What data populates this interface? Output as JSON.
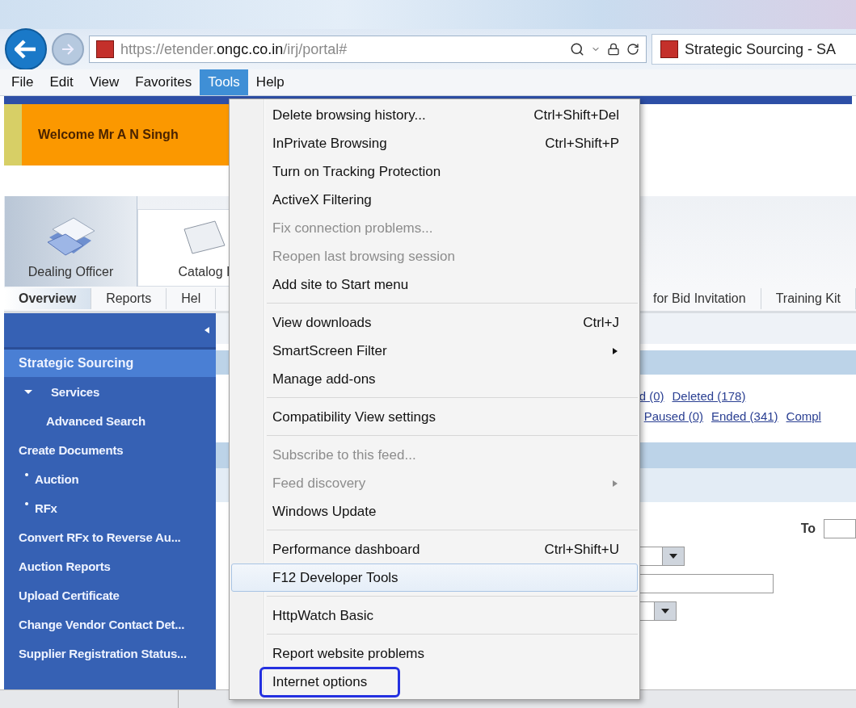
{
  "browser": {
    "address": "https://etender.**ongc.co.in**/irj/portal#",
    "tab_title": "Strategic Sourcing - SA"
  },
  "menu_bar": [
    {
      "label": "File",
      "selected": false
    },
    {
      "label": "Edit",
      "selected": false
    },
    {
      "label": "View",
      "selected": false
    },
    {
      "label": "Favorites",
      "selected": false
    },
    {
      "label": "Tools",
      "selected": true
    },
    {
      "label": "Help",
      "selected": false
    }
  ],
  "tools_menu": [
    [
      {
        "label": "Delete browsing history...",
        "shortcut": "Ctrl+Shift+Del",
        "disabled": false,
        "selected": false
      },
      {
        "label": "InPrivate Browsing",
        "shortcut": "Ctrl+Shift+P",
        "disabled": false,
        "selected": false
      },
      {
        "label": "Turn on Tracking Protection",
        "disabled": false,
        "selected": false
      },
      {
        "label": "ActiveX Filtering",
        "disabled": false,
        "selected": false
      },
      {
        "label": "Fix connection problems...",
        "disabled": true,
        "selected": false
      },
      {
        "label": "Reopen last browsing session",
        "disabled": true,
        "selected": false
      },
      {
        "label": "Add site to Start menu",
        "disabled": false,
        "selected": false
      }
    ],
    [
      {
        "label": "View downloads",
        "shortcut": "Ctrl+J",
        "disabled": false,
        "selected": false
      },
      {
        "label": "SmartScreen Filter",
        "submenu": true,
        "disabled": false,
        "selected": false
      },
      {
        "label": "Manage add-ons",
        "disabled": false,
        "selected": false
      }
    ],
    [
      {
        "label": "Compatibility View settings",
        "disabled": false,
        "selected": false
      }
    ],
    [
      {
        "label": "Subscribe to this feed...",
        "disabled": true,
        "selected": false
      },
      {
        "label": "Feed discovery",
        "submenu": true,
        "disabled": true,
        "selected": false
      },
      {
        "label": "Windows Update",
        "disabled": false,
        "selected": false
      }
    ],
    [
      {
        "label": "Performance dashboard",
        "shortcut": "Ctrl+Shift+U",
        "disabled": false,
        "selected": false
      },
      {
        "label": "F12 Developer Tools",
        "disabled": false,
        "selected": true
      }
    ],
    [
      {
        "label": "HttpWatch Basic",
        "disabled": false,
        "selected": false
      }
    ],
    [
      {
        "label": "Report website problems",
        "disabled": false,
        "selected": false
      },
      {
        "label": "Internet options",
        "disabled": false,
        "selected": false,
        "highlighted": true
      }
    ]
  ],
  "portal": {
    "welcome": "Welcome Mr A N Singh",
    "roles": [
      {
        "label": "Dealing Officer",
        "selected": true
      },
      {
        "label": "Catalog I",
        "selected": false
      }
    ],
    "subtabs": [
      {
        "label": "Overview",
        "selected": true
      },
      {
        "label": "Reports",
        "selected": false
      },
      {
        "label": "Hel",
        "selected": false
      }
    ],
    "subtabs_right": [
      "for Bid Invitation",
      "Training Kit"
    ],
    "sidebar": {
      "title": "Strategic Sourcing",
      "items": [
        {
          "label": "Services",
          "kind": "group",
          "expanded": true,
          "children": [
            {
              "label": "Advanced Search",
              "kind": "link"
            }
          ]
        },
        {
          "label": "Create Documents",
          "kind": "link",
          "children": [
            {
              "label": "Auction",
              "kind": "bullet"
            },
            {
              "label": "RFx",
              "kind": "bullet"
            }
          ]
        },
        {
          "label": "Convert RFx to Reverse Au...",
          "kind": "link"
        },
        {
          "label": "Auction Reports",
          "kind": "link"
        },
        {
          "label": "Upload Certificate",
          "kind": "link"
        },
        {
          "label": "Change Vendor Contact Det...",
          "kind": "link"
        },
        {
          "label": "Supplier Registration Status...",
          "kind": "link"
        }
      ]
    },
    "status_links": [
      [
        "d (0)",
        "Deleted (178)"
      ],
      [
        "Paused (0)",
        "Ended (341)",
        "Compl"
      ]
    ],
    "to_label": "To"
  }
}
